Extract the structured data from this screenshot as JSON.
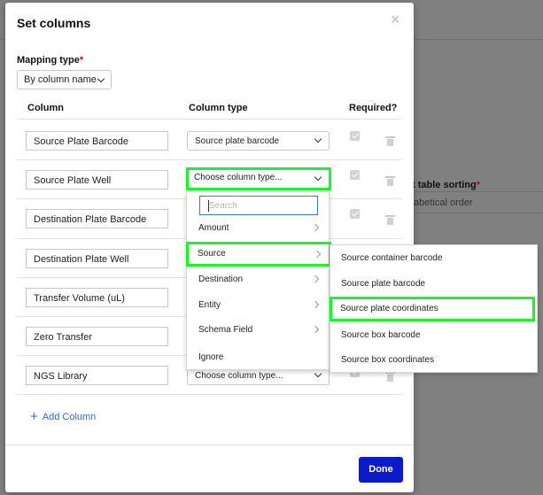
{
  "background": {
    "sort_label": "t table sorting",
    "sort_value": "abetical order"
  },
  "modal": {
    "title": "Set columns",
    "mapping_type_label": "Mapping type",
    "mapping_type_value": "By column name",
    "headers": {
      "column": "Column",
      "column_type": "Column type",
      "required": "Required?"
    },
    "rows": [
      {
        "name": "Source Plate Barcode",
        "type": "Source plate barcode"
      },
      {
        "name": "Source Plate Well",
        "type": "Choose column type..."
      },
      {
        "name": "Destination Plate Barcode",
        "type": ""
      },
      {
        "name": "Destination Plate Well",
        "type": ""
      },
      {
        "name": "Transfer Volume (uL)",
        "type": ""
      },
      {
        "name": "Zero Transfer",
        "type": ""
      },
      {
        "name": "NGS Library",
        "type": "Choose column type..."
      }
    ],
    "add_column_label": "Add Column",
    "done_label": "Done"
  },
  "dropdown": {
    "search_placeholder": "Search",
    "items": [
      "Amount",
      "Source",
      "Destination",
      "Entity",
      "Schema Field",
      "Ignore"
    ]
  },
  "submenu": {
    "items": [
      "Source container barcode",
      "Source plate barcode",
      "Source plate coordinates",
      "Source box barcode",
      "Source box coordinates"
    ]
  },
  "colors": {
    "highlight": "#19f52a",
    "primary": "#0c1bc9",
    "link": "#2f6bd6"
  }
}
